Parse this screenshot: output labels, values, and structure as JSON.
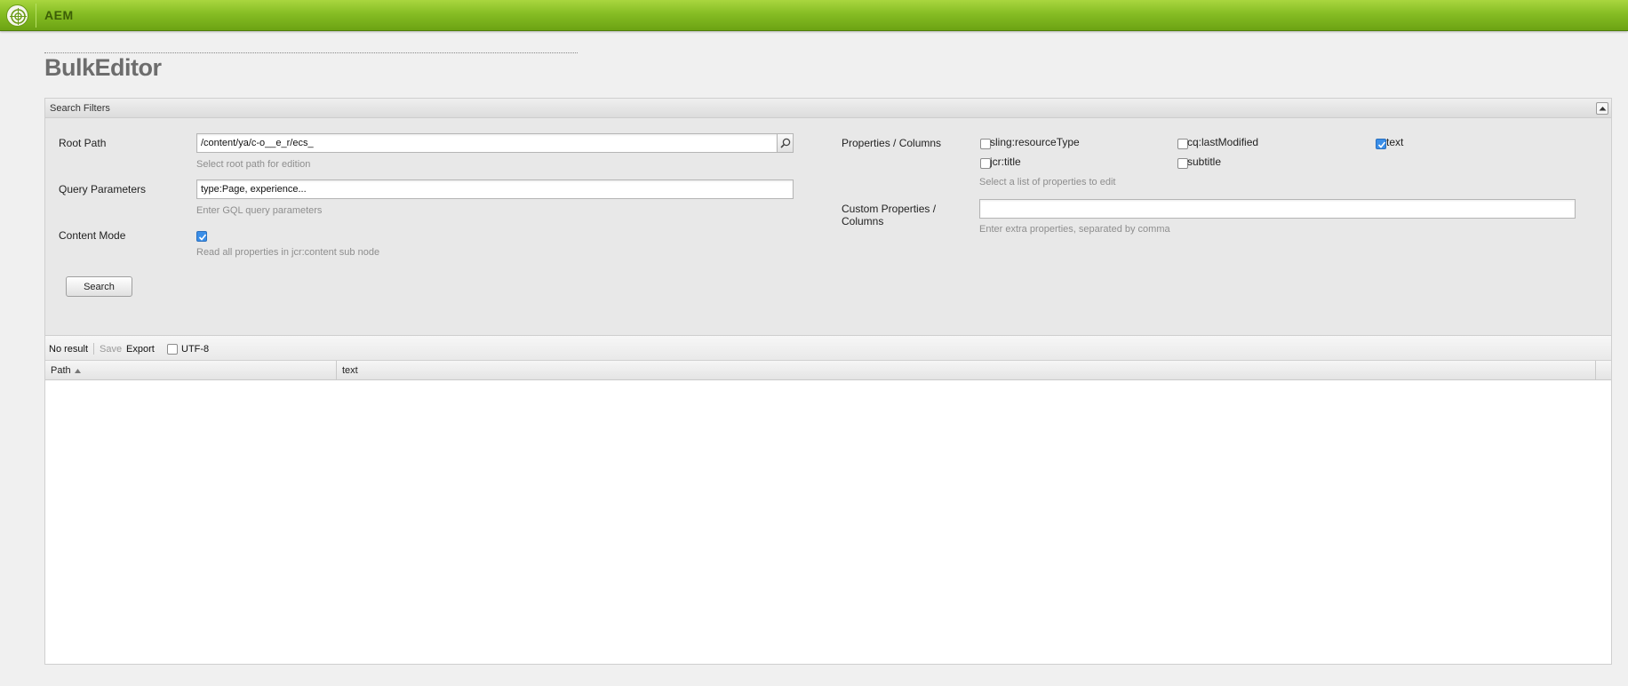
{
  "app": {
    "title": "AEM"
  },
  "page": {
    "title": "BulkEditor"
  },
  "search_filters": {
    "title": "Search Filters",
    "root_path": {
      "label": "Root Path",
      "value": "/content/ya/c-o__e_r/ecs_",
      "hint": "Select root path for edition"
    },
    "query_parameters": {
      "label": "Query Parameters",
      "value": "type:Page, experience...",
      "hint": "Enter GQL query parameters"
    },
    "content_mode": {
      "label": "Content Mode",
      "checked": true,
      "hint": "Read all properties in jcr:content sub node"
    },
    "search_button": "Search",
    "properties": {
      "label": "Properties / Columns",
      "options": [
        {
          "label": "sling:resourceType",
          "checked": false
        },
        {
          "label": "cq:lastModified",
          "checked": false
        },
        {
          "label": "text",
          "checked": true
        },
        {
          "label": "jcr:title",
          "checked": false
        },
        {
          "label": "subtitle",
          "checked": false
        }
      ],
      "hint": "Select a list of properties to edit"
    },
    "custom_properties": {
      "label_line1": "Custom Properties /",
      "label_line2": "Columns",
      "value": "",
      "hint": "Enter extra properties, separated by comma"
    }
  },
  "results": {
    "status": "No result",
    "save_label": "Save",
    "export_label": "Export",
    "utf8_label": "UTF-8",
    "utf8_checked": false,
    "columns": [
      {
        "label": "Path",
        "sorted": "asc"
      },
      {
        "label": "text"
      }
    ],
    "rows": []
  },
  "colors": {
    "topbar": "#86bd24",
    "checkbox_checked": "#3a8ee8",
    "disabled_text": "#9a9a9a"
  }
}
